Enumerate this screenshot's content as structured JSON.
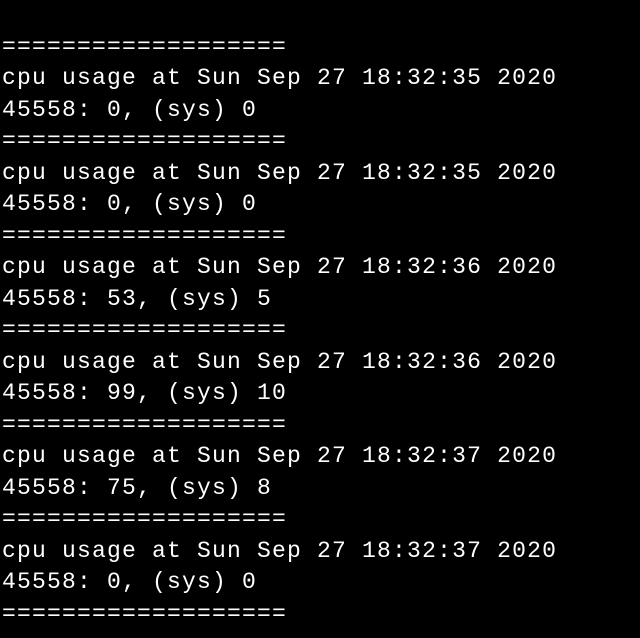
{
  "separator": "===================",
  "entries": [
    {
      "header": "cpu usage at Sun Sep 27 18:32:35 2020",
      "pid_line": "45558: 0, (sys) 0"
    },
    {
      "header": "cpu usage at Sun Sep 27 18:32:35 2020",
      "pid_line": "45558: 0, (sys) 0"
    },
    {
      "header": "cpu usage at Sun Sep 27 18:32:36 2020",
      "pid_line": "45558: 53, (sys) 5"
    },
    {
      "header": "cpu usage at Sun Sep 27 18:32:36 2020",
      "pid_line": "45558: 99, (sys) 10"
    },
    {
      "header": "cpu usage at Sun Sep 27 18:32:37 2020",
      "pid_line": "45558: 75, (sys) 8"
    },
    {
      "header": "cpu usage at Sun Sep 27 18:32:37 2020",
      "pid_line": "45558: 0, (sys) 0"
    }
  ]
}
